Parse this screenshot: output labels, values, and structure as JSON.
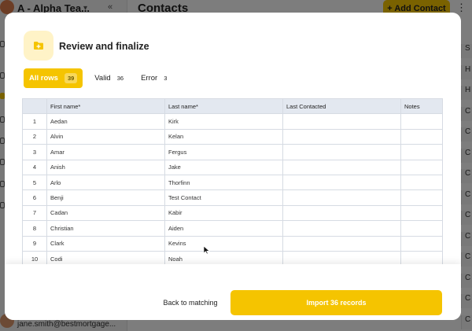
{
  "background": {
    "team_name": "A - Alpha Tea...",
    "page_title": "Contacts",
    "add_button": "+ Add Contact",
    "user_email": "jane.smith@bestmortgage...",
    "right_letters": [
      "S",
      "H",
      "H",
      "C",
      "C",
      "C",
      "C",
      "C",
      "C",
      "C",
      "C",
      "C",
      "C",
      "C"
    ]
  },
  "modal": {
    "title": "Review and finalize",
    "tabs": [
      {
        "label": "All rows",
        "count": "39",
        "active": true
      },
      {
        "label": "Valid",
        "count": "36",
        "active": false
      },
      {
        "label": "Error",
        "count": "3",
        "active": false
      }
    ],
    "table": {
      "headers": [
        "",
        "First name*",
        "Last name*",
        "Last Contacted",
        "Notes"
      ],
      "rows": [
        [
          "1",
          "Aedan",
          "Kirk",
          "",
          ""
        ],
        [
          "2",
          "Alvin",
          "Kelan",
          "",
          ""
        ],
        [
          "3",
          "Amar",
          "Fergus",
          "",
          ""
        ],
        [
          "4",
          "Anish",
          "Jake",
          "",
          ""
        ],
        [
          "5",
          "Arlo",
          "Thorfinn",
          "",
          ""
        ],
        [
          "6",
          "Benji",
          "Test Contact",
          "",
          ""
        ],
        [
          "7",
          "Cadan",
          "Kabir",
          "",
          ""
        ],
        [
          "8",
          "Christian",
          "Aiden",
          "",
          ""
        ],
        [
          "9",
          "Clark",
          "Kevins",
          "",
          ""
        ],
        [
          "10",
          "Codi",
          "Noah",
          "",
          ""
        ],
        [
          "11",
          "",
          "",
          "",
          ""
        ]
      ]
    },
    "footer": {
      "back_label": "Back to matching",
      "import_label": "Import 36 records"
    }
  },
  "colors": {
    "accent": "#f5c400",
    "header_bg": "#e3e8f0",
    "icon_tile": "#fff3c7"
  }
}
